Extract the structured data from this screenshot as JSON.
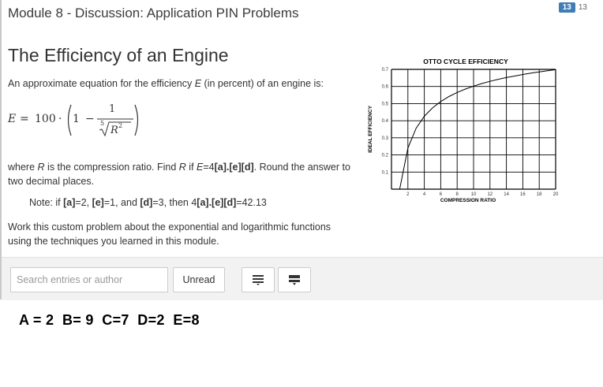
{
  "header": {
    "title": "Module 8 - Discussion: Application PIN Problems",
    "unread_count": "13",
    "total_count": "13"
  },
  "content": {
    "title": "The Efficiency of an Engine",
    "intro_prefix": "An approximate equation for the efficiency ",
    "intro_var": "E",
    "intro_suffix": " (in percent) of an engine is:",
    "equation": {
      "lhs": "E",
      "eq": "=",
      "coef": "100",
      "dot": "·",
      "one": "1",
      "minus": "−",
      "numerator": "1",
      "root_index": "5",
      "radicand": "R",
      "exponent": "2"
    },
    "where": {
      "p1": "where ",
      "v1": "R",
      "p2": " is the compression ratio. Find ",
      "v2": "R",
      "p3": " if ",
      "v3": "E",
      "p4": "=4",
      "b1": "[a].[e][d]",
      "p5": ". Round the answer to two decimal places."
    },
    "note": {
      "p1": "Note: if ",
      "a": "[a]",
      "p2": "=2, ",
      "e": "[e]",
      "p3": "=1, and ",
      "d": "[d]",
      "p4": "=3, then 4",
      "combo": "[a].[e][d]",
      "p5": "=42.13"
    },
    "work": "Work this custom problem about the exponential and logarithmic functions using the techniques you learned in this module."
  },
  "toolbar": {
    "search_placeholder": "Search entries or author",
    "unread_label": "Unread",
    "expand_icon": "list-expand-icon",
    "collapse_icon": "list-collapse-icon"
  },
  "annotation": "A = 2  B= 9  C=7  D=2  E=8",
  "chart_data": {
    "type": "line",
    "title": "OTTO CYCLE EFFICIENCY",
    "xlabel": "COMPRESSION RATIO",
    "ylabel": "IDEAL EFFICIENCY",
    "xlim": [
      0,
      20
    ],
    "ylim": [
      0,
      0.7
    ],
    "xticks": [
      "2",
      "4",
      "6",
      "8",
      "10",
      "12",
      "14",
      "16",
      "18",
      "20"
    ],
    "yticks": [
      "0.1",
      "0.2",
      "0.3",
      "0.4",
      "0.5",
      "0.6",
      "0.7"
    ],
    "grid": true,
    "series": [
      {
        "x": [
          1,
          2,
          3,
          4,
          5,
          6,
          7,
          8,
          9,
          10,
          11,
          12,
          13,
          14,
          15,
          16,
          17,
          18,
          19,
          20
        ],
        "values": [
          0.0,
          0.24,
          0.356,
          0.426,
          0.475,
          0.512,
          0.541,
          0.565,
          0.585,
          0.602,
          0.617,
          0.63,
          0.642,
          0.652,
          0.661,
          0.67,
          0.678,
          0.685,
          0.692,
          0.698
        ]
      }
    ],
    "line_color": "#000000"
  }
}
